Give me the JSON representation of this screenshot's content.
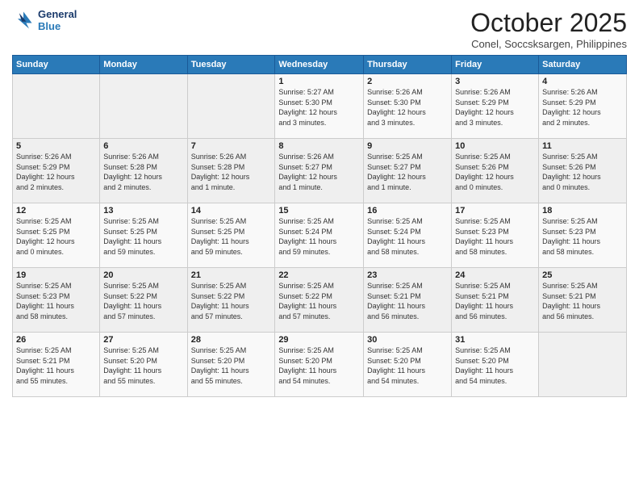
{
  "header": {
    "logo_line1": "General",
    "logo_line2": "Blue",
    "month": "October 2025",
    "location": "Conel, Soccsksargen, Philippines"
  },
  "days_of_week": [
    "Sunday",
    "Monday",
    "Tuesday",
    "Wednesday",
    "Thursday",
    "Friday",
    "Saturday"
  ],
  "weeks": [
    [
      {
        "day": "",
        "info": ""
      },
      {
        "day": "",
        "info": ""
      },
      {
        "day": "",
        "info": ""
      },
      {
        "day": "1",
        "info": "Sunrise: 5:27 AM\nSunset: 5:30 PM\nDaylight: 12 hours\nand 3 minutes."
      },
      {
        "day": "2",
        "info": "Sunrise: 5:26 AM\nSunset: 5:30 PM\nDaylight: 12 hours\nand 3 minutes."
      },
      {
        "day": "3",
        "info": "Sunrise: 5:26 AM\nSunset: 5:29 PM\nDaylight: 12 hours\nand 3 minutes."
      },
      {
        "day": "4",
        "info": "Sunrise: 5:26 AM\nSunset: 5:29 PM\nDaylight: 12 hours\nand 2 minutes."
      }
    ],
    [
      {
        "day": "5",
        "info": "Sunrise: 5:26 AM\nSunset: 5:29 PM\nDaylight: 12 hours\nand 2 minutes."
      },
      {
        "day": "6",
        "info": "Sunrise: 5:26 AM\nSunset: 5:28 PM\nDaylight: 12 hours\nand 2 minutes."
      },
      {
        "day": "7",
        "info": "Sunrise: 5:26 AM\nSunset: 5:28 PM\nDaylight: 12 hours\nand 1 minute."
      },
      {
        "day": "8",
        "info": "Sunrise: 5:26 AM\nSunset: 5:27 PM\nDaylight: 12 hours\nand 1 minute."
      },
      {
        "day": "9",
        "info": "Sunrise: 5:25 AM\nSunset: 5:27 PM\nDaylight: 12 hours\nand 1 minute."
      },
      {
        "day": "10",
        "info": "Sunrise: 5:25 AM\nSunset: 5:26 PM\nDaylight: 12 hours\nand 0 minutes."
      },
      {
        "day": "11",
        "info": "Sunrise: 5:25 AM\nSunset: 5:26 PM\nDaylight: 12 hours\nand 0 minutes."
      }
    ],
    [
      {
        "day": "12",
        "info": "Sunrise: 5:25 AM\nSunset: 5:25 PM\nDaylight: 12 hours\nand 0 minutes."
      },
      {
        "day": "13",
        "info": "Sunrise: 5:25 AM\nSunset: 5:25 PM\nDaylight: 11 hours\nand 59 minutes."
      },
      {
        "day": "14",
        "info": "Sunrise: 5:25 AM\nSunset: 5:25 PM\nDaylight: 11 hours\nand 59 minutes."
      },
      {
        "day": "15",
        "info": "Sunrise: 5:25 AM\nSunset: 5:24 PM\nDaylight: 11 hours\nand 59 minutes."
      },
      {
        "day": "16",
        "info": "Sunrise: 5:25 AM\nSunset: 5:24 PM\nDaylight: 11 hours\nand 58 minutes."
      },
      {
        "day": "17",
        "info": "Sunrise: 5:25 AM\nSunset: 5:23 PM\nDaylight: 11 hours\nand 58 minutes."
      },
      {
        "day": "18",
        "info": "Sunrise: 5:25 AM\nSunset: 5:23 PM\nDaylight: 11 hours\nand 58 minutes."
      }
    ],
    [
      {
        "day": "19",
        "info": "Sunrise: 5:25 AM\nSunset: 5:23 PM\nDaylight: 11 hours\nand 58 minutes."
      },
      {
        "day": "20",
        "info": "Sunrise: 5:25 AM\nSunset: 5:22 PM\nDaylight: 11 hours\nand 57 minutes."
      },
      {
        "day": "21",
        "info": "Sunrise: 5:25 AM\nSunset: 5:22 PM\nDaylight: 11 hours\nand 57 minutes."
      },
      {
        "day": "22",
        "info": "Sunrise: 5:25 AM\nSunset: 5:22 PM\nDaylight: 11 hours\nand 57 minutes."
      },
      {
        "day": "23",
        "info": "Sunrise: 5:25 AM\nSunset: 5:21 PM\nDaylight: 11 hours\nand 56 minutes."
      },
      {
        "day": "24",
        "info": "Sunrise: 5:25 AM\nSunset: 5:21 PM\nDaylight: 11 hours\nand 56 minutes."
      },
      {
        "day": "25",
        "info": "Sunrise: 5:25 AM\nSunset: 5:21 PM\nDaylight: 11 hours\nand 56 minutes."
      }
    ],
    [
      {
        "day": "26",
        "info": "Sunrise: 5:25 AM\nSunset: 5:21 PM\nDaylight: 11 hours\nand 55 minutes."
      },
      {
        "day": "27",
        "info": "Sunrise: 5:25 AM\nSunset: 5:20 PM\nDaylight: 11 hours\nand 55 minutes."
      },
      {
        "day": "28",
        "info": "Sunrise: 5:25 AM\nSunset: 5:20 PM\nDaylight: 11 hours\nand 55 minutes."
      },
      {
        "day": "29",
        "info": "Sunrise: 5:25 AM\nSunset: 5:20 PM\nDaylight: 11 hours\nand 54 minutes."
      },
      {
        "day": "30",
        "info": "Sunrise: 5:25 AM\nSunset: 5:20 PM\nDaylight: 11 hours\nand 54 minutes."
      },
      {
        "day": "31",
        "info": "Sunrise: 5:25 AM\nSunset: 5:20 PM\nDaylight: 11 hours\nand 54 minutes."
      },
      {
        "day": "",
        "info": ""
      }
    ]
  ]
}
